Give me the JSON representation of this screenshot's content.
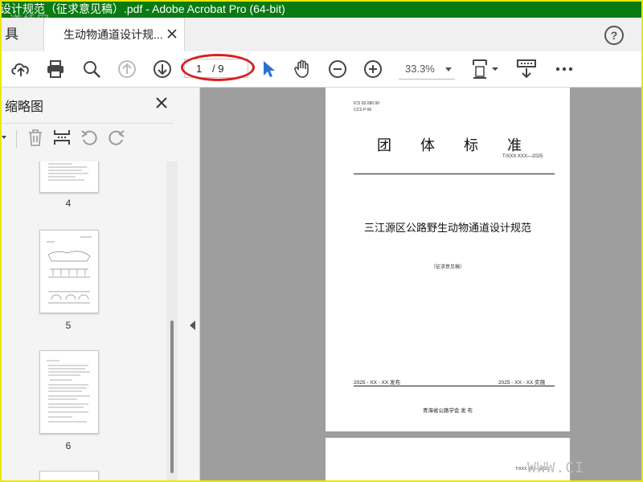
{
  "window": {
    "title": "设计规范（征求意见稿）.pdf - Adobe Acrobat Pro (64-bit)",
    "watermark_top": "道桥网"
  },
  "tabs": {
    "tools_label": "具",
    "doc_tab_label": "生动物通道设计规..."
  },
  "toolbar": {
    "current_page": "1",
    "total_pages": "/ 9",
    "zoom": "33.3%"
  },
  "sidepanel": {
    "title": "缩略图",
    "thumbnails": [
      {
        "number": "4"
      },
      {
        "number": "5"
      },
      {
        "number": "6"
      }
    ]
  },
  "document": {
    "page1": {
      "ics": "ICS  93.080.99",
      "ccs": "CCS  P 66",
      "big_title_chars": [
        "团",
        "体",
        "标",
        "准"
      ],
      "std_code": "T/XXX XXX—2025",
      "name": "三江源区公路野生动物通道设计规范",
      "draft_note": "（征求意见稿）",
      "publish": "2025 - XX - XX 发布",
      "implement": "2025 - XX - XX 实施",
      "org": "青海省公路学会      发  布"
    },
    "page2": {
      "std_code": "T/XXX XXX—2025"
    }
  },
  "watermark_bottom": "WWW.CI",
  "colors": {
    "titlebar": "#0a7a12",
    "frame": "#e8e800",
    "annotation": "#d82020",
    "select_tool": "#2a6fd6"
  }
}
